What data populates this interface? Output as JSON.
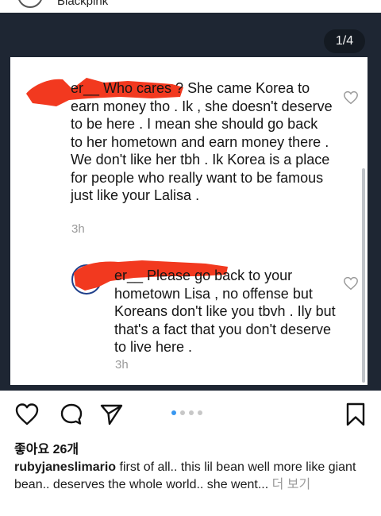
{
  "header": {
    "username": "Blackpink"
  },
  "carousel": {
    "counter": "1/4",
    "total_dots": 4,
    "active_dot": 1
  },
  "comments": [
    {
      "name_tail": "er__",
      "text": " Who cares ? She came Korea to earn money tho . Ik , she doesn't deserve to be here . I mean she should go back to her hometown and earn money there . We don't like her tbh . Ik Korea is a place for people who really want to be famous just like your Lalisa .",
      "time": "3h"
    },
    {
      "name_tail": "er__",
      "text": " Please go back to your hometown Lisa , no offense but Koreans don't like you tbvh . Ily but that's a fact that you don't deserve to live here .",
      "time": "3h"
    }
  ],
  "post": {
    "likes": "좋아요 26개",
    "caption_user": "rubyjaneslimario",
    "caption_text": " first of all.. this lil bean well more like giant bean.. deserves the whole world.. she went...",
    "more_label": " 더 보기"
  },
  "colors": {
    "photo_bg": "#1e2633",
    "redaction": "#f2391f",
    "dot_active": "#3897f0",
    "dot_inactive": "#c7c7c7"
  },
  "icons": [
    "heart-icon",
    "comment-icon",
    "share-icon",
    "bookmark-icon"
  ]
}
